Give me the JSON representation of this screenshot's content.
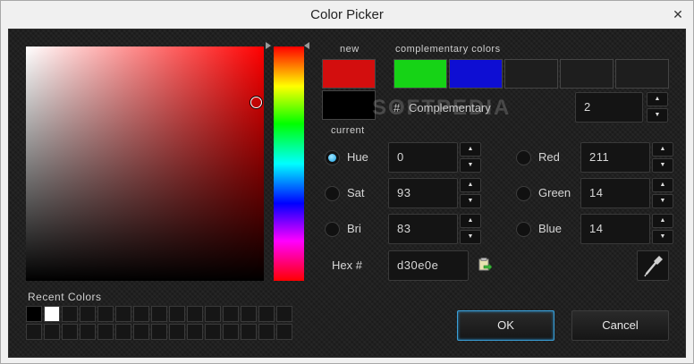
{
  "window": {
    "title": "Color Picker",
    "close_glyph": "✕"
  },
  "labels": {
    "new": "new",
    "current": "current",
    "complementary_colors": "complementary colors",
    "recent_colors": "Recent Colors",
    "hex": "Hex #"
  },
  "swatches": {
    "new_color": "#d30e0e",
    "current_color": "#000000",
    "complementary": [
      "#16d316",
      "#0e0ed3",
      "#1e1e1e",
      "#1e1e1e",
      "#1e1e1e"
    ]
  },
  "complementary_mode": {
    "hash": "#",
    "label": "Complementary",
    "count": "2"
  },
  "watermark": "SOFTPEDIA",
  "hsb": {
    "hue": {
      "label": "Hue",
      "value": "0",
      "selected": true
    },
    "sat": {
      "label": "Sat",
      "value": "93",
      "selected": false
    },
    "bri": {
      "label": "Bri",
      "value": "83",
      "selected": false
    }
  },
  "rgb": {
    "red": {
      "label": "Red",
      "value": "211",
      "selected": false
    },
    "green": {
      "label": "Green",
      "value": "14",
      "selected": false
    },
    "blue": {
      "label": "Blue",
      "value": "14",
      "selected": false
    }
  },
  "hex_value": "d30e0e",
  "spin": {
    "up": "▲",
    "down": "▼"
  },
  "recent_colors": [
    "#000000",
    "#ffffff"
  ],
  "buttons": {
    "ok": "OK",
    "cancel": "Cancel"
  },
  "icons": {
    "eyedropper": "eyedropper-icon",
    "paste": "paste-icon",
    "close": "close-icon"
  }
}
